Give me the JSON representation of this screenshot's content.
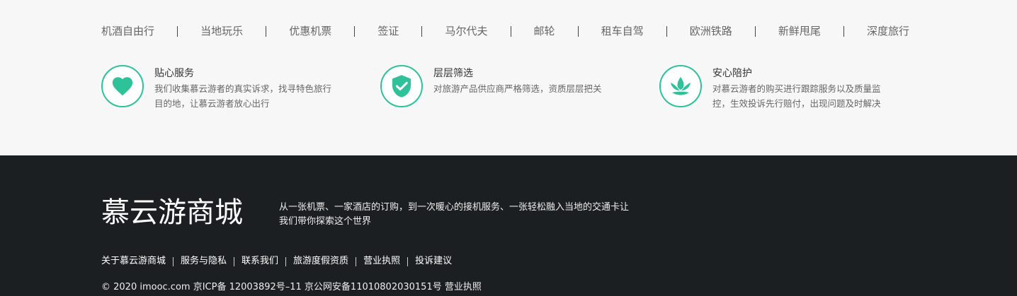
{
  "nav": {
    "items": [
      "机酒自由行",
      "当地玩乐",
      "优惠机票",
      "签证",
      "马尔代夫",
      "邮轮",
      "租车自驾",
      "欧洲铁路",
      "新鲜甩尾",
      "深度旅行"
    ]
  },
  "features": [
    {
      "icon": "heart-icon",
      "title": "贴心服务",
      "desc_line1": "我们收集慕云游者的真实诉求，找寻特色旅行",
      "desc_line2": "目的地，让慕云游者放心出行"
    },
    {
      "icon": "shield-check-icon",
      "title": "层层筛选",
      "desc_line1": "对旅游产品供应商严格筛选，资质层层把关",
      "desc_line2": ""
    },
    {
      "icon": "lotus-icon",
      "title": "安心陪护",
      "desc_line1": "对慕云游者的购买进行跟踪服务以及质量监",
      "desc_line2": "控，生效投诉先行赔付，出现问题及时解决"
    }
  ],
  "footer": {
    "logo": "慕云游商城",
    "slogan_line1": "从一张机票、一家酒店的订购，到一次暖心的接机服务、一张轻松融入当地的交通卡让",
    "slogan_line2": "我们带你探索这个世界",
    "links": [
      "关于慕云游商城",
      "服务与隐私",
      "联系我们",
      "旅游度假资质",
      "营业执照",
      "投诉建议"
    ],
    "copyright": "© 2020 imooc.com  京ICP备 12003892号–11 京公网安备11010802030151号 营业执照"
  },
  "colors": {
    "accent": "#2ec29a",
    "footer_bg": "#1c1f21",
    "top_bg": "#f7f7f7"
  }
}
